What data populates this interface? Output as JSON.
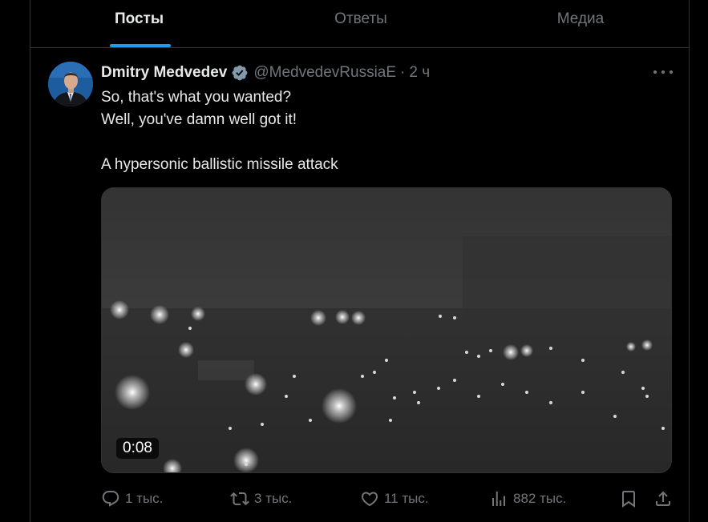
{
  "tabs": [
    {
      "label": "Посты",
      "active": true
    },
    {
      "label": "Ответы",
      "active": false
    },
    {
      "label": "Медиа",
      "active": false
    }
  ],
  "tweet": {
    "author_name": "Dmitry Medvedev",
    "verified": true,
    "handle": "@MedvedevRussiaE",
    "separator": "·",
    "time": "2 ч",
    "lines": [
      "So, that's what you wanted?",
      "Well, you've damn well got it!",
      "",
      "A hypersonic ballistic missile attack"
    ],
    "media": {
      "type": "video",
      "duration": "0:08"
    },
    "actions": {
      "replies": "1 тыс.",
      "reposts": "3 тыс.",
      "likes": "11 тыс.",
      "views": "882 тыс."
    }
  },
  "colors": {
    "background": "#000000",
    "accent": "#1d9bf0",
    "text": "#e7e9ea",
    "muted": "#71767b",
    "border": "#2f3336"
  },
  "icons": [
    "verified-badge-icon",
    "more-icon",
    "reply-icon",
    "repost-icon",
    "like-icon",
    "views-icon",
    "bookmark-icon",
    "share-icon"
  ]
}
